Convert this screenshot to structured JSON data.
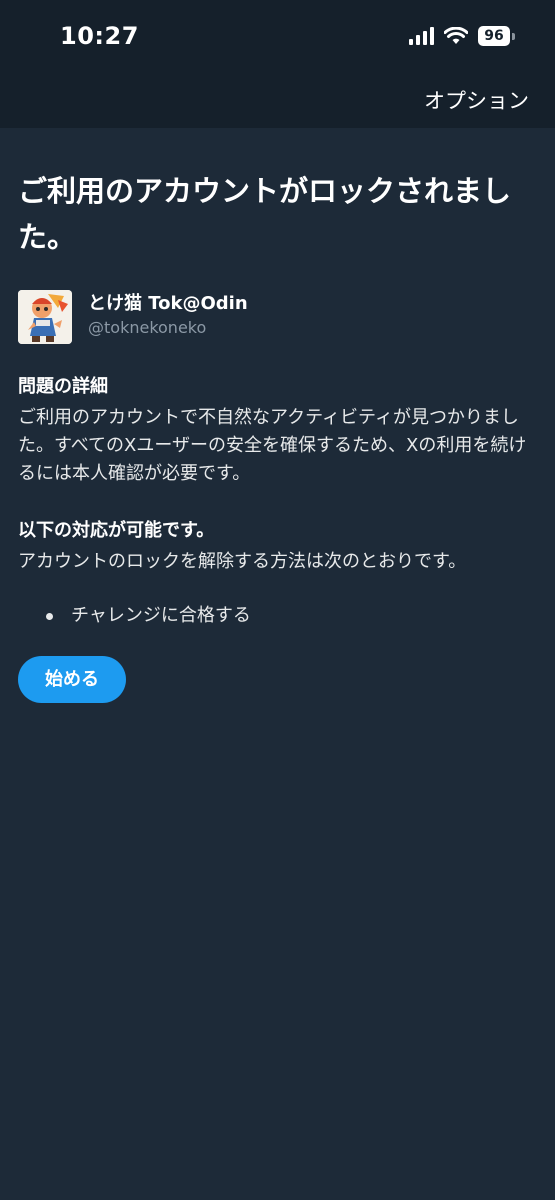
{
  "status_bar": {
    "time": "10:27",
    "battery": "96"
  },
  "header": {
    "options_label": "オプション"
  },
  "main": {
    "title": "ご利用のアカウントがロックされました。",
    "account": {
      "display_name": "とけ猫 Tok@Odin",
      "handle": "@toknekoneko"
    },
    "details_heading": "問題の詳細",
    "details_text": "ご利用のアカウントで不自然なアクティビティが見つかりました。すべてのXユーザーの安全を確保するため、Xの利用を続けるには本人確認が必要です。",
    "actions_heading": "以下の対応が可能です。",
    "actions_text": "アカウントのロックを解除する方法は次のとおりです。",
    "options_list": [
      "チャレンジに合格する"
    ],
    "start_label": "始める"
  },
  "colors": {
    "background": "#1d2a38",
    "header_background": "#15202b",
    "accent": "#1d9bf0",
    "secondary_text": "#8b98a5"
  },
  "icons": [
    "signal-icon",
    "wifi-icon",
    "battery-icon"
  ]
}
